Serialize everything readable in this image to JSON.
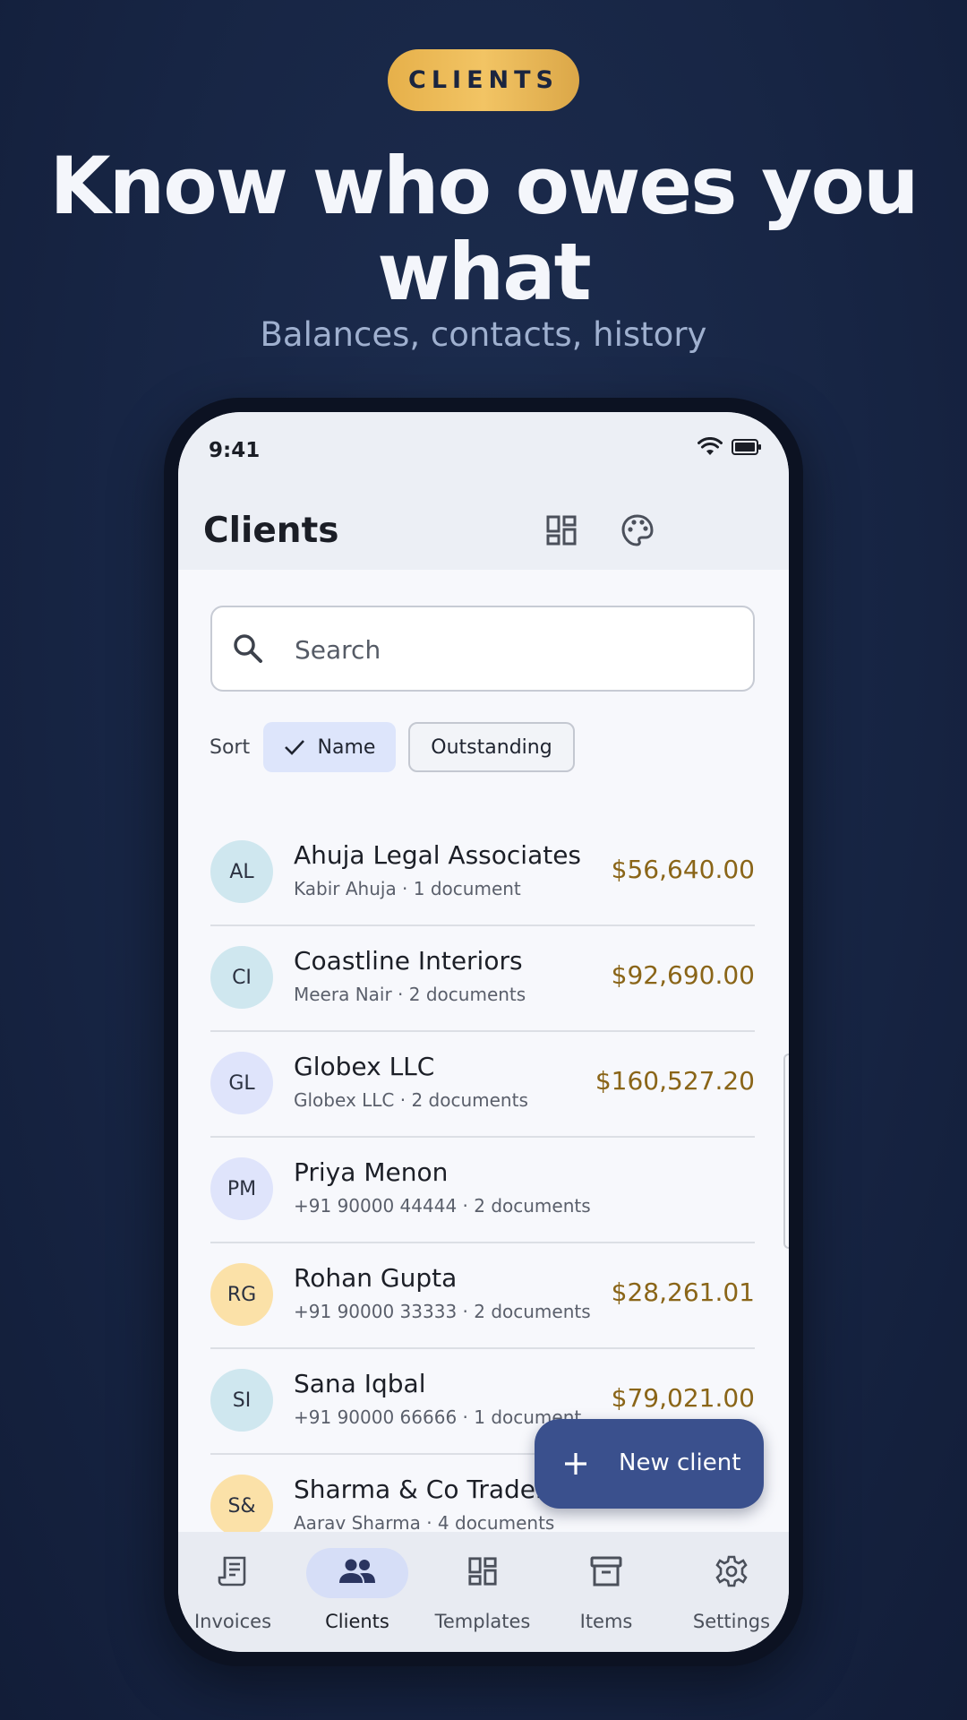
{
  "marketing": {
    "badge": "CLIENTS",
    "headline_line1": "Know who owes you",
    "headline_line2": "what",
    "subheadline": "Balances, contacts, history"
  },
  "status_bar": {
    "time": "9:41"
  },
  "app_bar": {
    "title": "Clients",
    "actions": [
      "templates-icon",
      "palette-icon"
    ]
  },
  "search": {
    "placeholder": "Search"
  },
  "sort": {
    "label": "Sort",
    "options": [
      {
        "label": "Name",
        "selected": true
      },
      {
        "label": "Outstanding",
        "selected": false
      }
    ]
  },
  "clients": [
    {
      "initials": "AL",
      "name": "Ahuja Legal Associates",
      "subtitle": "Kabir Ahuja · 1 document",
      "amount": "$56,640.00",
      "avatar_color": "#cfe7ef"
    },
    {
      "initials": "CI",
      "name": "Coastline Interiors",
      "subtitle": "Meera Nair · 2 documents",
      "amount": "$92,690.00",
      "avatar_color": "#cfe7ef"
    },
    {
      "initials": "GL",
      "name": "Globex LLC",
      "subtitle": "Globex LLC · 2 documents",
      "amount": "$160,527.20",
      "avatar_color": "#dfe4fb"
    },
    {
      "initials": "PM",
      "name": "Priya Menon",
      "subtitle": "+91 90000 44444 · 2 documents",
      "amount": "",
      "avatar_color": "#dfe4fb"
    },
    {
      "initials": "RG",
      "name": "Rohan Gupta",
      "subtitle": "+91 90000 33333 · 2 documents",
      "amount": "$28,261.01",
      "avatar_color": "#fbe1a8"
    },
    {
      "initials": "SI",
      "name": "Sana Iqbal",
      "subtitle": "+91 90000 66666 · 1 document",
      "amount": "$79,021.00",
      "avatar_color": "#cfe7ef"
    },
    {
      "initials": "S&",
      "name": "Sharma & Co Traders",
      "subtitle": "Aarav Sharma · 4 documents",
      "amount": "",
      "avatar_color": "#fbe1a8"
    }
  ],
  "fab": {
    "label": "New client"
  },
  "bottom_nav": [
    {
      "label": "Invoices",
      "icon": "invoice-icon",
      "active": false
    },
    {
      "label": "Clients",
      "icon": "people-icon",
      "active": true
    },
    {
      "label": "Templates",
      "icon": "templates-icon",
      "active": false
    },
    {
      "label": "Items",
      "icon": "archive-icon",
      "active": false
    },
    {
      "label": "Settings",
      "icon": "gear-icon",
      "active": false
    }
  ],
  "colors": {
    "accent": "#3a508d",
    "amount": "#8a6518",
    "badge": "#f2c464",
    "background": "#172544"
  }
}
